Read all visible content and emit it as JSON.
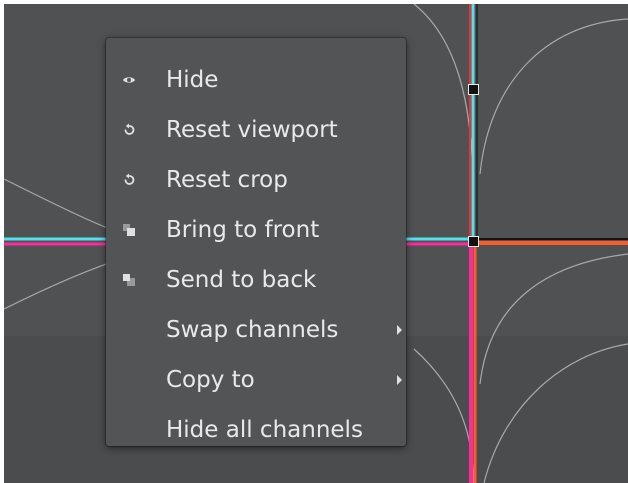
{
  "context_menu": {
    "items": [
      {
        "label": "Hide",
        "icon": "eye-icon"
      },
      {
        "label": "Reset viewport",
        "icon": "reset-icon"
      },
      {
        "label": "Reset crop",
        "icon": "reset-icon"
      },
      {
        "label": "Bring to front",
        "icon": "bring-to-front-icon"
      },
      {
        "label": "Send to back",
        "icon": "send-to-back-icon"
      },
      {
        "label": "Swap channels",
        "icon": "",
        "submenu": true
      },
      {
        "label": "Copy to",
        "icon": "",
        "submenu": true
      },
      {
        "label": "Hide all channels",
        "icon": ""
      }
    ]
  },
  "colors": {
    "background": "#4f5153",
    "menu_background": "#525456",
    "text": "#e9e9e9",
    "line_cyan": "#4fe3ef",
    "line_magenta": "#ff2a9d",
    "line_orange": "#ff5a2a"
  }
}
